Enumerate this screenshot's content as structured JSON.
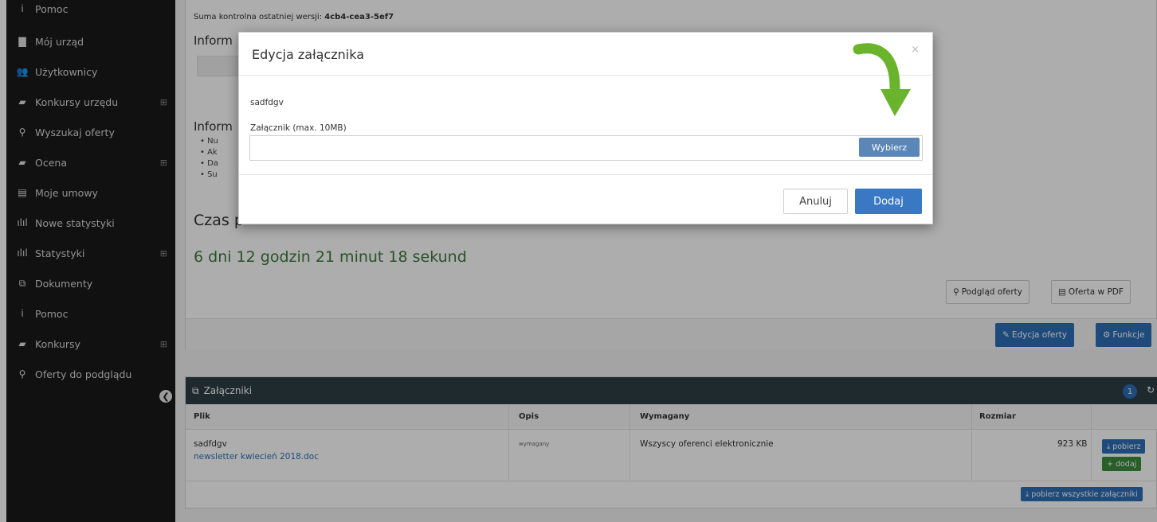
{
  "sidebar": {
    "items": [
      {
        "label": "Pomoc",
        "icon": "info-circle-icon",
        "glyph": "i"
      },
      {
        "label": "Mój urząd",
        "icon": "building-icon",
        "glyph": "▇"
      },
      {
        "label": "Użytkownicy",
        "icon": "users-icon",
        "glyph": "👥"
      },
      {
        "label": "Konkursy urzędu",
        "icon": "book-icon",
        "glyph": "▰",
        "expand": "⊞"
      },
      {
        "label": "Wyszukaj oferty",
        "icon": "search-icon",
        "glyph": "⚲"
      },
      {
        "label": "Ocena",
        "icon": "book-icon",
        "glyph": "▰",
        "expand": "⊞"
      },
      {
        "label": "Moje umowy",
        "icon": "file-icon",
        "glyph": "▤"
      },
      {
        "label": "Nowe statystyki",
        "icon": "bar-chart-icon",
        "glyph": "ılıl"
      },
      {
        "label": "Statystyki",
        "icon": "bar-chart-icon",
        "glyph": "ılıl",
        "expand": "⊞"
      },
      {
        "label": "Dokumenty",
        "icon": "documents-icon",
        "glyph": "⧉"
      },
      {
        "label": "Pomoc",
        "icon": "info-circle-icon",
        "glyph": "i"
      },
      {
        "label": "Konkursy",
        "icon": "book-icon",
        "glyph": "▰",
        "expand": "⊞"
      },
      {
        "label": "Oferty do podglądu",
        "icon": "search-icon",
        "glyph": "⚲"
      }
    ],
    "collapse_glyph": "❮"
  },
  "main": {
    "checksum_label": "Suma kontrolna ostatniej wersji:",
    "checksum_value": "4cb4-cea3-5ef7",
    "section1_title": "Inform",
    "section2_title": "Inform",
    "bullets": [
      "Nu",
      "Ak",
      "Da",
      "Su"
    ],
    "czas_label": "Czas p",
    "countdown": "6 dni 12 godzin 21 minut 18 sekund",
    "preview_btn": "Podgląd oferty",
    "pdf_btn": "Oferta w PDF",
    "edit_btn": "Edycja oferty",
    "functions_btn": "Funkcje"
  },
  "attachments": {
    "title": "Załączniki",
    "count": "1",
    "columns": [
      "Plik",
      "Opis",
      "Wymagany",
      "Rozmiar"
    ],
    "rows": [
      {
        "name": "sadfdgv",
        "file": "newsletter kwiecień 2018.doc",
        "description": "wymagany",
        "required": "Wszyscy oferenci elektronicznie",
        "size": "923 KB",
        "download": "pobierz",
        "add": "dodaj"
      }
    ],
    "download_all": "pobierz wszystkie załączniki"
  },
  "modal": {
    "title": "Edycja załącznika",
    "close": "×",
    "file_name": "sadfdgv",
    "field_label": "Załącznik (max. 10MB)",
    "choose_btn": "Wybierz",
    "cancel_btn": "Anuluj",
    "add_btn": "Dodaj"
  },
  "colors": {
    "primary": "#2d6fb7",
    "success": "#3b8b3b",
    "sidebar_bg": "#1a1a1a",
    "panel_header": "#2e3e46",
    "arrow": "#6ab42d",
    "countdown": "#3c7a3c"
  }
}
